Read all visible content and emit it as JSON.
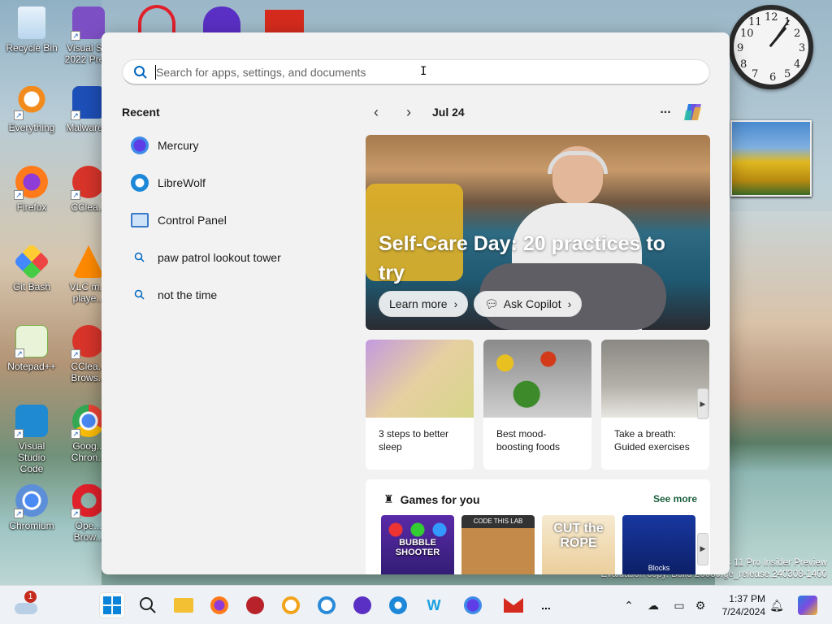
{
  "desktop": {
    "icons": [
      {
        "label": "Recycle Bin"
      },
      {
        "label": "Visual S... 2022 Pre..."
      },
      {
        "label": "Everything"
      },
      {
        "label": "Malware..."
      },
      {
        "label": "Firefox"
      },
      {
        "label": "CClea..."
      },
      {
        "label": "Git Bash"
      },
      {
        "label": "VLC m... playe..."
      },
      {
        "label": "Notepad++"
      },
      {
        "label": "CClea... Brows..."
      },
      {
        "label": "Visual Studio Code"
      },
      {
        "label": "Goog... Chron..."
      },
      {
        "label": "Chromium"
      },
      {
        "label": "Ope... Brow..."
      }
    ],
    "watermark_line1": "s 11 Pro Insider Preview",
    "watermark_line2": "Evaluation copy. Build 26080.ge_release.240308-1400"
  },
  "search": {
    "placeholder": "Search for apps, settings, and documents",
    "value": ""
  },
  "recent": {
    "title": "Recent",
    "items": [
      {
        "label": "Mercury",
        "icon": "mercury-icon"
      },
      {
        "label": "LibreWolf",
        "icon": "librewolf-icon"
      },
      {
        "label": "Control Panel",
        "icon": "control-panel-icon"
      },
      {
        "label": "paw patrol lookout tower",
        "icon": "search-icon"
      },
      {
        "label": "not the time",
        "icon": "search-icon"
      }
    ]
  },
  "highlights": {
    "date": "Jul 24",
    "more": "...",
    "hero": {
      "title": "Self-Care Day: 20 practices to try",
      "learn_more": "Learn more",
      "ask_copilot": "Ask Copilot"
    },
    "cards": [
      {
        "text": "3 steps to better sleep"
      },
      {
        "text": "Best mood-boosting foods"
      },
      {
        "text": "Take a breath: Guided exercises"
      }
    ]
  },
  "games": {
    "title": "Games for you",
    "see_more": "See more",
    "tiles": [
      {
        "name": "BUBBLE SHOOTER"
      },
      {
        "name": "CODE THIS LAB"
      },
      {
        "name": "CUT the ROPE"
      },
      {
        "name": "Blocks"
      }
    ]
  },
  "taskbar": {
    "notification_badge": "1",
    "more": "...",
    "time": "1:37 PM",
    "date": "7/24/2024"
  },
  "colors": {
    "accent": "#0067c0",
    "see_more": "#1a5f3c",
    "panel_bg": "#f2f2f2"
  }
}
